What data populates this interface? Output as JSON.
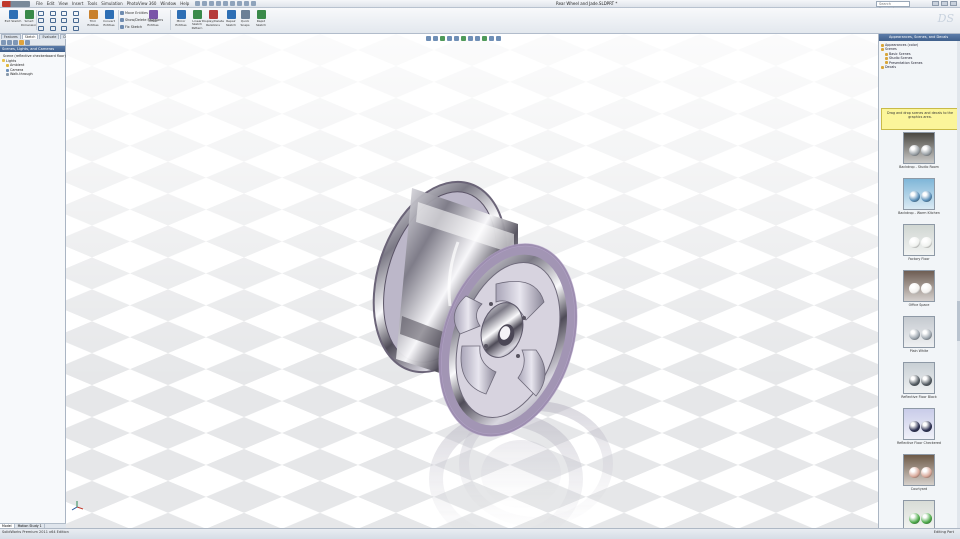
{
  "app": {
    "title": "Rear Wheel and Jade.SLDPRT *",
    "logo_text": "SOLIDWORKS"
  },
  "menus": [
    "File",
    "Edit",
    "View",
    "Insert",
    "Tools",
    "Simulation",
    "PhotoView 360",
    "Window",
    "Help"
  ],
  "search": {
    "placeholder": "Search Knowledge"
  },
  "ribbon": {
    "items": [
      {
        "label": "Exit Sketch"
      },
      {
        "label": "Smart Dimension"
      },
      {
        "label": "Trim Entities"
      },
      {
        "label": "Convert Entities"
      },
      {
        "label": "Offset Entities"
      },
      {
        "label": "Mirror Entities"
      },
      {
        "label": "Linear Sketch Pattern"
      },
      {
        "label": "Display/Delete Relations"
      },
      {
        "label": "Repair Sketch"
      },
      {
        "label": "Quick Snaps"
      },
      {
        "label": "Rapid Sketch"
      }
    ],
    "small_items": [
      "Move Entities",
      "Show/Delete Relations",
      "Fix Sketch"
    ]
  },
  "command_tabs": [
    "Features",
    "Sketch",
    "Evaluate",
    "DimXpert",
    "Office Products",
    "Surfaces",
    "Weldments",
    "Render Tools",
    "Sheet Metal",
    "Simulation"
  ],
  "left_panel": {
    "header": "Scenes, Lights, and Cameras",
    "tree": [
      "Scene (reflective checkerboard floor)",
      "Lights",
      "Ambient",
      "Camera",
      "Walk-through"
    ],
    "bottom_tabs": [
      "Model",
      "Motion Study 1"
    ]
  },
  "task_pane": {
    "header": "Appearances, Scenes, and Decals",
    "tree": [
      "Appearances (color)",
      "Scenes",
      "Basic Scenes",
      "Studio Scenes",
      "Presentation Scenes",
      "Decals"
    ],
    "tip": "Drag and drop scenes and decals to the graphics area.",
    "swatches": [
      {
        "label": "Backdrop - Studio Room",
        "color": "#4a4842",
        "ball": "#9aa1a6"
      },
      {
        "label": "Backdrop - Warm Kitchen",
        "color": "#7fb6d8",
        "ball": "#5b8fb8"
      },
      {
        "label": "Factory Floor",
        "color": "#d0d6d2",
        "ball": "#f0f2ef"
      },
      {
        "label": "Office Space",
        "color": "#6e5d53",
        "ball": "#f3f1ee"
      },
      {
        "label": "Plain White",
        "color": "#c5cad0",
        "ball": "#9ca5ae"
      },
      {
        "label": "Reflective Floor Black",
        "color": "#c8cfd4",
        "ball": "#545c63"
      },
      {
        "label": "Reflective Floor Checkered",
        "color": "#c9cce9",
        "ball": "#2d3152"
      },
      {
        "label": "Courtyard",
        "color": "#6e5a48",
        "ball": "#d9a99a"
      },
      {
        "label": "Green Screen",
        "color": "#d8dcd6",
        "ball": "#4caa48"
      }
    ]
  },
  "status": {
    "left": "SolidWorks Premium 2011 x64 Edition",
    "right": "Editing Part"
  },
  "colors": {
    "accent": "#40608c",
    "wheel_rim": "#9d8fae",
    "tip_bg": "#fbf59a"
  }
}
